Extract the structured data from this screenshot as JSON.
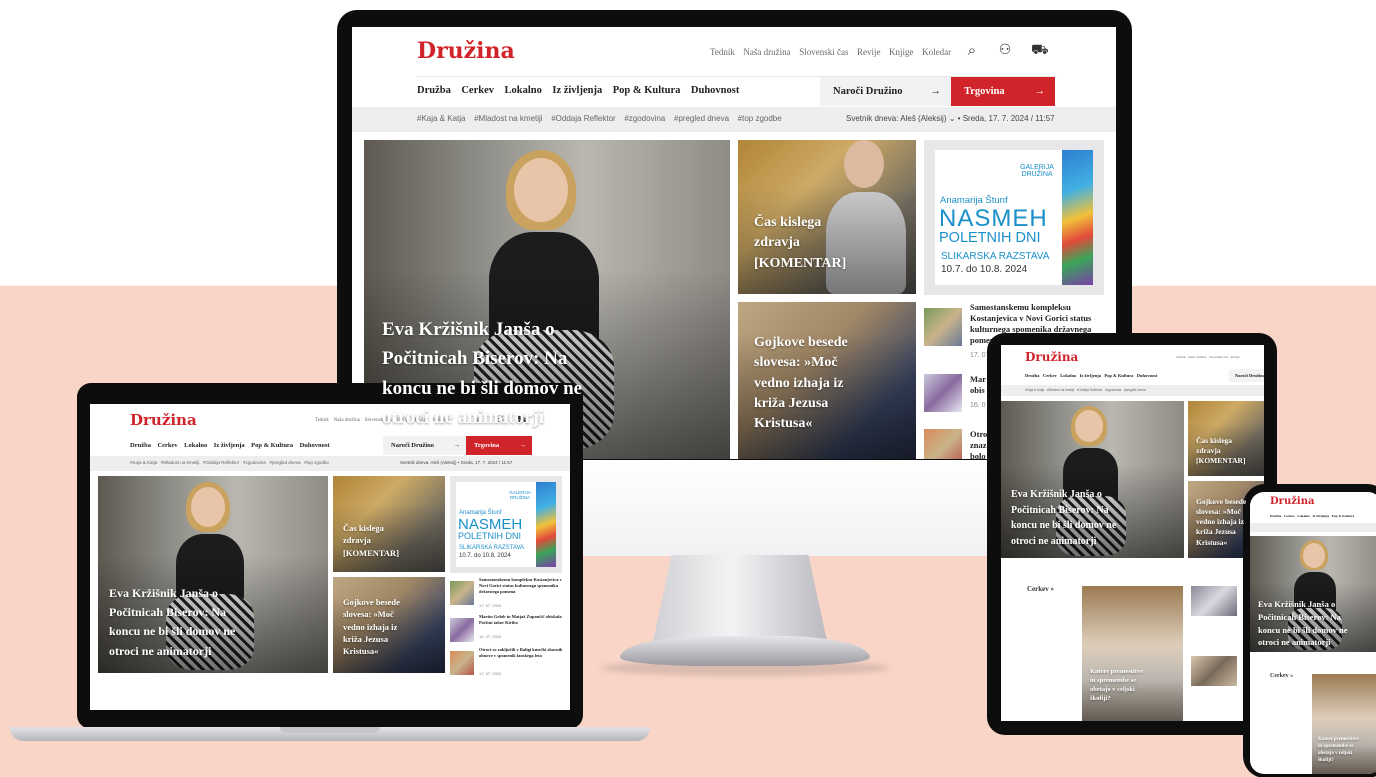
{
  "site": {
    "logo": "Družina",
    "top_links": [
      "Tednik",
      "Naša družina",
      "Slovenski čas",
      "Revije",
      "Knjige",
      "Koledar"
    ],
    "nav_items": [
      "Družba",
      "Cerkev",
      "Lokalno",
      "Iz življenja",
      "Pop & Kultura",
      "Duhovnost"
    ],
    "subscribe_label": "Naroči Družino",
    "shop_label": "Trgovina",
    "arrow": "→",
    "tags": [
      "#Kaja & Katja",
      "#Mladost na kmetiji",
      "#Oddaja Reflektor",
      "#zgodovina",
      "#pregled dneva",
      "#top zgodbe"
    ],
    "saint_of_day": "Svetnik dneva: Aleš (Aleksij)",
    "date_time": "Sreda, 17. 7. 2024 / 11:57",
    "icons": {
      "search": "⌕",
      "user": "⚇",
      "cart": "⛟",
      "chevron": "⌄"
    }
  },
  "articles": {
    "hero_title": "Eva Kržišnik Janša o Počitnicah Biserov: Na koncu ne bi šli domov ne otroci ne animatorji",
    "hero_title_monitor_l1": "Eva Kržišnik Janša o",
    "hero_title_monitor_l2": "Počitnicah Biserov: Na",
    "hero_title_monitor_l3": "koncu ne bi šli domov ne",
    "hero_title_monitor_l4": "otroci ne animatorji",
    "commentary_title_l1": "Čas kislega",
    "commentary_title_l2": "zdravja",
    "commentary_title_l3": "[KOMENTAR]",
    "gojko_l1": "Gojkove besede",
    "gojko_l2": "slovesa: »Moč",
    "gojko_l3": "vedno izhaja iz",
    "gojko_l4": "križa Jezusa",
    "gojko_l5": "Kristusa«",
    "list": [
      {
        "title": "Samostanskemu kompleksu Kostanjevica v Novi Gorici status kulturnega spomenika državnega pomena",
        "date": "17. 07. 2024"
      },
      {
        "title": "Martin Golob in Matjaž Zupančič obiskala Počitni tabor Kiribo",
        "date": "16. 07. 2024"
      },
      {
        "title": "Otroci so zaključili v Baligi kmečki zbornik obnove v spomenik lanskega leta",
        "date": "17. 07. 2024"
      }
    ],
    "list_item1_l1": "Samostanskemu kompleksu",
    "list_item1_l2": "Kostanjevica v Novi Gorici status",
    "list_item1_l3": "kulturnega spomenika državnega",
    "list_item1_l4": "pomena",
    "list_item1_date": "17. 07.",
    "list_item2_l1": "Mar",
    "list_item2_l2": "obis",
    "list_item2_date": "16. 0",
    "list_item3_l1": "Otro",
    "list_item3_l2": "znaz",
    "list_item3_l3": "bolo"
  },
  "ad": {
    "gallery_l1": "GALERIJA",
    "gallery_l2": "DRUŽINA",
    "author": "Anamarija Štunf",
    "title_l1": "NASMEH",
    "title_l2": "POLETNIH DNI",
    "subtitle": "SLIKARSKA RAZSTAVA",
    "dates": "10.7. do 10.8. 2024"
  },
  "section": {
    "title": "Cerkev »",
    "feature_title": "Katere premestitve in spremembe se obetajo v celjski škofiji?",
    "feature_l1": "Katere premestitve",
    "feature_l2": "in spremembe se",
    "feature_l3": "obetajo v celjski",
    "feature_l4": "škofiji?"
  },
  "colors": {
    "brand_red": "#d1232a",
    "peach_bg": "#f9d5c8",
    "ad_blue": "#1a8fc9"
  }
}
